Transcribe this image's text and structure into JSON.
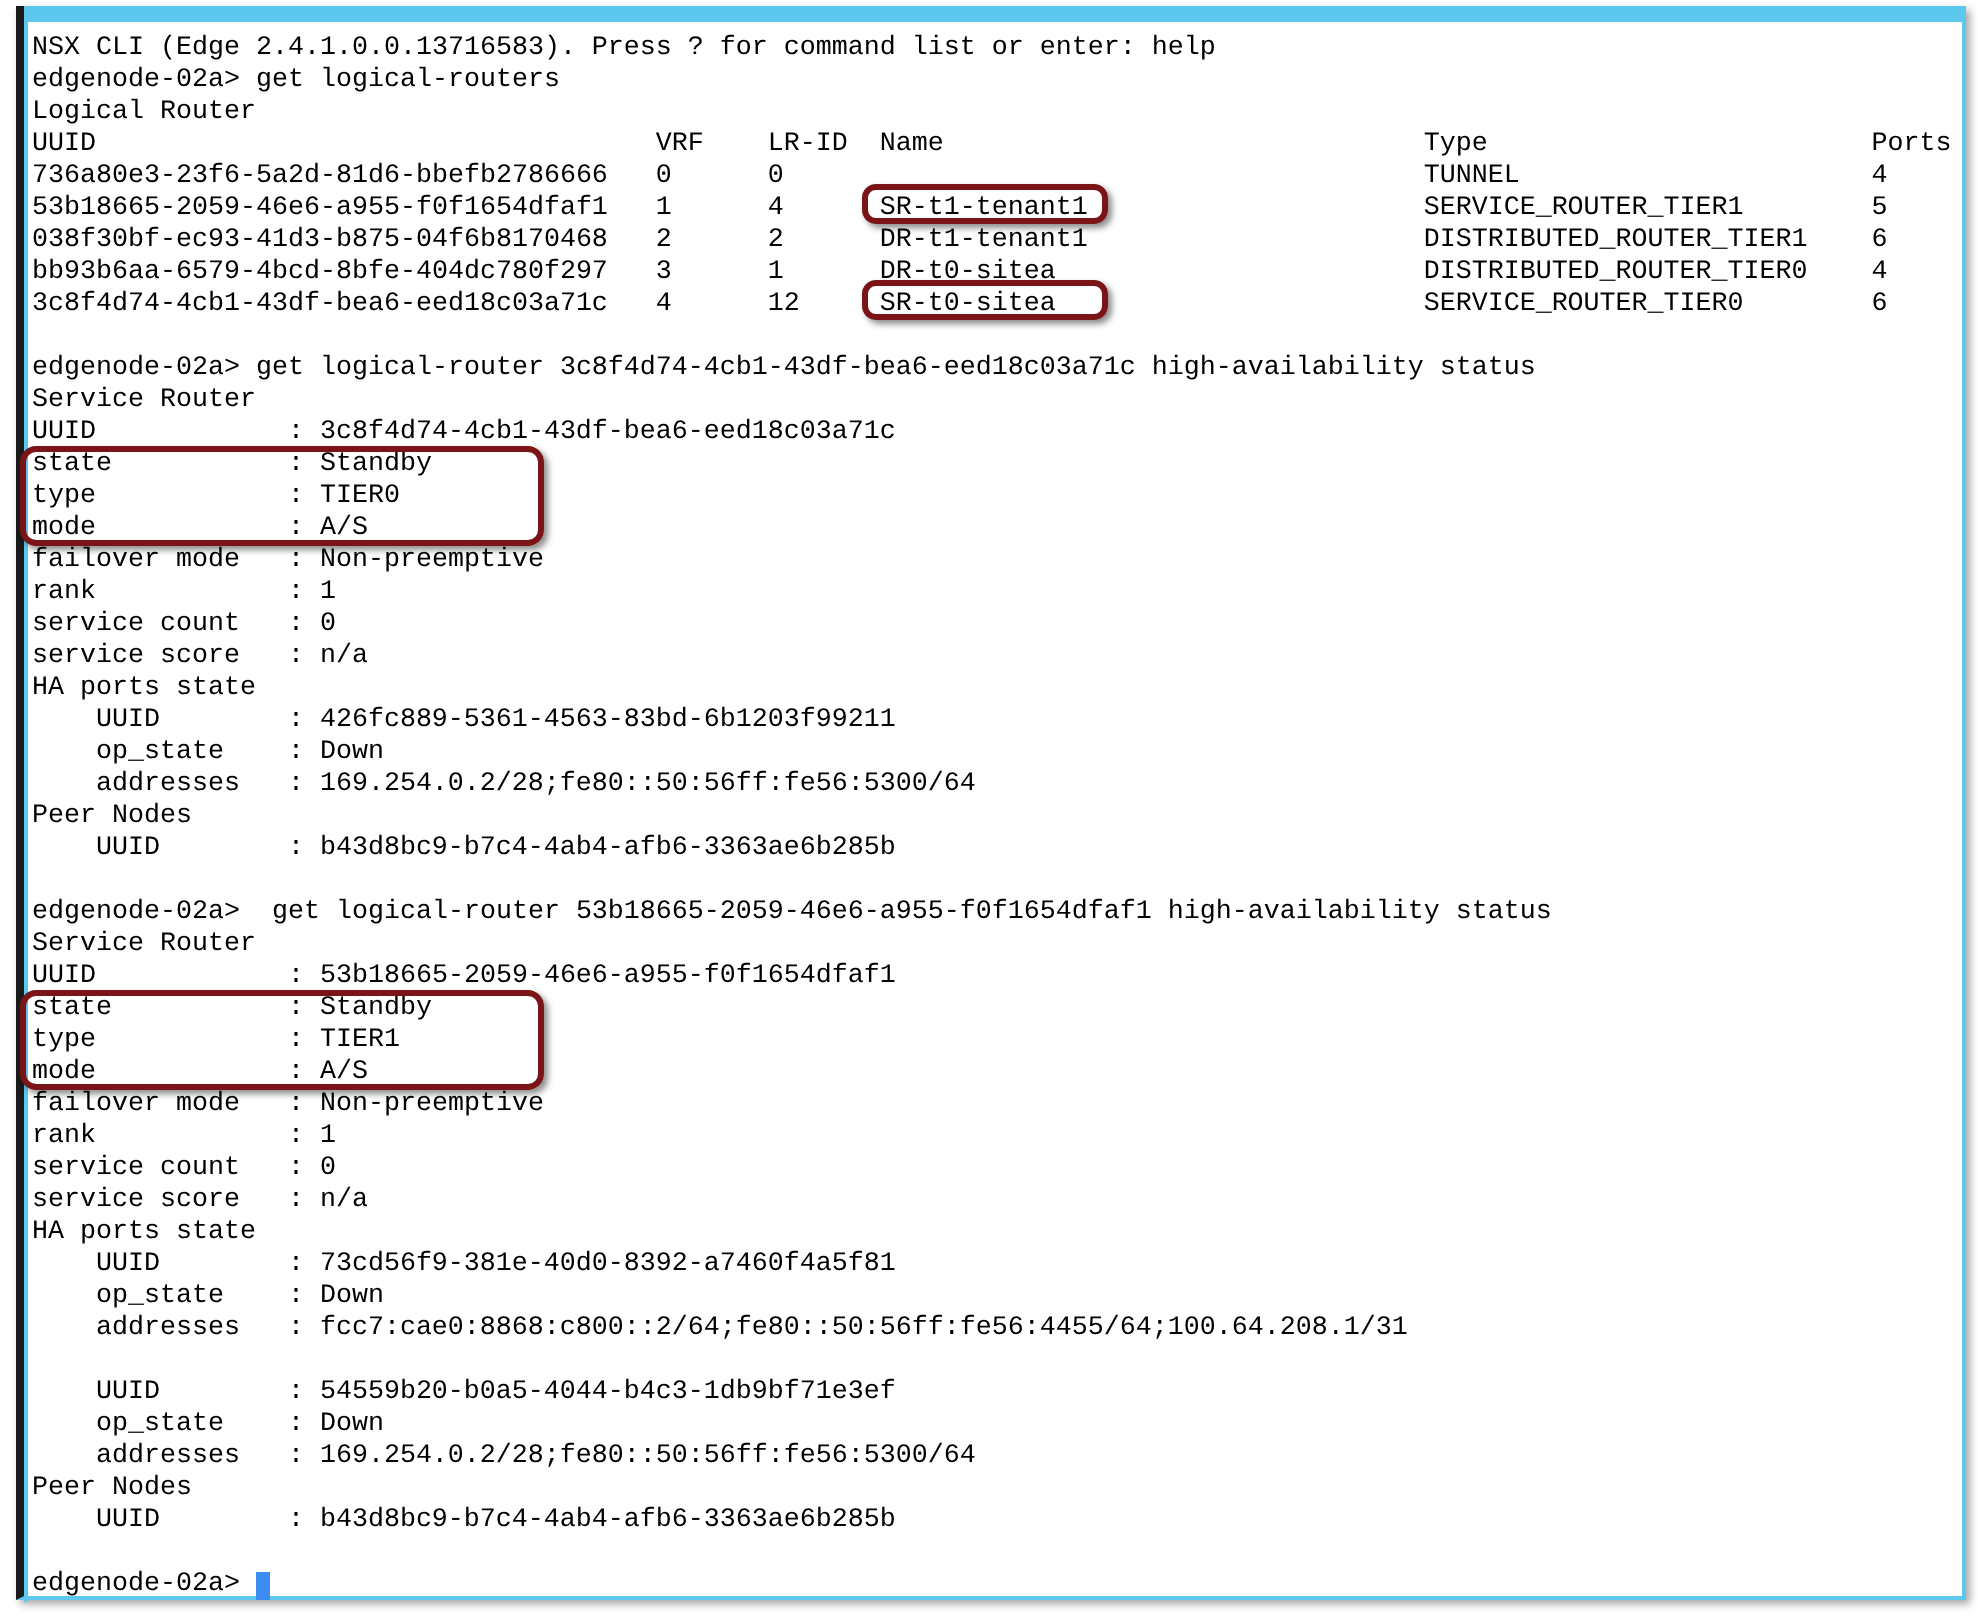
{
  "terminal": {
    "lines": [
      {
        "kind": "text",
        "text": "NSX CLI (Edge 2.4.1.0.0.13716583). Press ? for command list or enter: help"
      },
      {
        "kind": "prompt",
        "text": "edgenode-02a> get logical-routers"
      },
      {
        "kind": "text",
        "text": "Logical Router"
      },
      {
        "kind": "table",
        "columns": [
          "UUID",
          "VRF",
          "LR-ID",
          "Name",
          "Type",
          "Ports"
        ],
        "rows": [
          {
            "cells": [
              "736a80e3-23f6-5a2d-81d6-bbefb2786666",
              "0",
              "0",
              "",
              "TUNNEL",
              "4"
            ],
            "highlighted": false
          },
          {
            "cells": [
              "53b18665-2059-46e6-a955-f0f1654dfaf1",
              "1",
              "4",
              "SR-t1-tenant1",
              "SERVICE_ROUTER_TIER1",
              "5"
            ],
            "highlighted": true
          },
          {
            "cells": [
              "038f30bf-ec93-41d3-b875-04f6b8170468",
              "2",
              "2",
              "DR-t1-tenant1",
              "DISTRIBUTED_ROUTER_TIER1",
              "6"
            ],
            "highlighted": false
          },
          {
            "cells": [
              "bb93b6aa-6579-4bcd-8bfe-404dc780f297",
              "3",
              "1",
              "DR-t0-sitea",
              "DISTRIBUTED_ROUTER_TIER0",
              "4"
            ],
            "highlighted": false
          },
          {
            "cells": [
              "3c8f4d74-4cb1-43df-bea6-eed18c03a71c",
              "4",
              "12",
              "SR-t0-sitea",
              "SERVICE_ROUTER_TIER0",
              "6"
            ],
            "highlighted": true
          }
        ]
      },
      {
        "kind": "blank"
      },
      {
        "kind": "prompt",
        "text": "edgenode-02a> get logical-router 3c8f4d74-4cb1-43df-bea6-eed18c03a71c high-availability status"
      },
      {
        "kind": "text",
        "text": "Service Router"
      },
      {
        "kind": "field",
        "key": "UUID",
        "value": ": 3c8f4d74-4cb1-43df-bea6-eed18c03a71c",
        "highlighted": false
      },
      {
        "kind": "field",
        "key": "state",
        "value": ": Standby",
        "highlighted": true
      },
      {
        "kind": "field",
        "key": "type",
        "value": ": TIER0",
        "highlighted": true
      },
      {
        "kind": "field",
        "key": "mode",
        "value": ": A/S",
        "highlighted": true
      },
      {
        "kind": "field",
        "key": "failover mode",
        "value": ": Non-preemptive",
        "highlighted": false
      },
      {
        "kind": "field",
        "key": "rank",
        "value": ": 1",
        "highlighted": false
      },
      {
        "kind": "field",
        "key": "service count",
        "value": ": 0",
        "highlighted": false
      },
      {
        "kind": "field",
        "key": "service score",
        "value": ": n/a",
        "highlighted": false
      },
      {
        "kind": "section",
        "text": "HA ports state",
        "children": [
          {
            "kind": "field",
            "key": "UUID",
            "value": ": 426fc889-5361-4563-83bd-6b1203f99211"
          },
          {
            "kind": "field",
            "key": "op_state",
            "value": ": Down"
          },
          {
            "kind": "field",
            "key": "addresses",
            "value": ": 169.254.0.2/28;fe80::50:56ff:fe56:5300/64"
          }
        ]
      },
      {
        "kind": "section",
        "text": "Peer Nodes",
        "children": [
          {
            "kind": "field",
            "key": "UUID",
            "value": ": b43d8bc9-b7c4-4ab4-afb6-3363ae6b285b"
          }
        ]
      },
      {
        "kind": "blank"
      },
      {
        "kind": "prompt",
        "text": "edgenode-02a>  get logical-router 53b18665-2059-46e6-a955-f0f1654dfaf1 high-availability status"
      },
      {
        "kind": "text",
        "text": "Service Router"
      },
      {
        "kind": "field",
        "key": "UUID",
        "value": ": 53b18665-2059-46e6-a955-f0f1654dfaf1",
        "highlighted": false
      },
      {
        "kind": "field",
        "key": "state",
        "value": ": Standby",
        "highlighted": true
      },
      {
        "kind": "field",
        "key": "type",
        "value": ": TIER1",
        "highlighted": true
      },
      {
        "kind": "field",
        "key": "mode",
        "value": ": A/S",
        "highlighted": true
      },
      {
        "kind": "field",
        "key": "failover mode",
        "value": ": Non-preemptive",
        "highlighted": false
      },
      {
        "kind": "field",
        "key": "rank",
        "value": ": 1",
        "highlighted": false
      },
      {
        "kind": "field",
        "key": "service count",
        "value": ": 0",
        "highlighted": false
      },
      {
        "kind": "field",
        "key": "service score",
        "value": ": n/a",
        "highlighted": false
      },
      {
        "kind": "section",
        "text": "HA ports state",
        "children": [
          {
            "kind": "field",
            "key": "UUID",
            "value": ": 73cd56f9-381e-40d0-8392-a7460f4a5f81"
          },
          {
            "kind": "field",
            "key": "op_state",
            "value": ": Down"
          },
          {
            "kind": "field",
            "key": "addresses",
            "value": ": fcc7:cae0:8868:c800::2/64;fe80::50:56ff:fe56:4455/64;100.64.208.1/31"
          },
          {
            "kind": "blank"
          },
          {
            "kind": "field",
            "key": "UUID",
            "value": ": 54559b20-b0a5-4044-b4c3-1db9bf71e3ef"
          },
          {
            "kind": "field",
            "key": "op_state",
            "value": ": Down"
          },
          {
            "kind": "field",
            "key": "addresses",
            "value": ": 169.254.0.2/28;fe80::50:56ff:fe56:5300/64"
          }
        ]
      },
      {
        "kind": "section",
        "text": "Peer Nodes",
        "children": [
          {
            "kind": "field",
            "key": "UUID",
            "value": ": b43d8bc9-b7c4-4ab4-afb6-3363ae6b285b"
          }
        ]
      },
      {
        "kind": "blank"
      },
      {
        "kind": "input",
        "text": "edgenode-02a>"
      }
    ]
  }
}
